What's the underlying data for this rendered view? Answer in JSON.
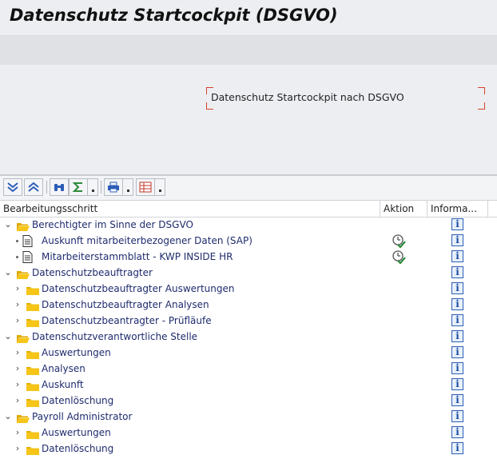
{
  "window": {
    "title": "Datenschutz Startcockpit (DSGVO)"
  },
  "header": {
    "text": "Datenschutz Startcockpit nach DSGVO"
  },
  "toolbar": {
    "buttons": [
      {
        "name": "expand-all-button",
        "icon": "expand-down-icon"
      },
      {
        "name": "collapse-all-button",
        "icon": "collapse-up-icon"
      },
      {
        "name": "find-button",
        "icon": "binoculars-icon"
      },
      {
        "name": "sum-button",
        "icon": "sigma-icon"
      },
      {
        "name": "print-button",
        "icon": "printer-icon"
      },
      {
        "name": "layout-button",
        "icon": "grid-layout-icon"
      }
    ]
  },
  "table": {
    "columns": {
      "step": "Bearbeitungsschritt",
      "action": "Aktion",
      "info": "Informa..."
    },
    "rows": [
      {
        "label": "Berechtigter im Sinne der DSGVO",
        "level": 0,
        "type": "folder-open",
        "expanded": true,
        "action": false
      },
      {
        "label": "Auskunft mitarbeiterbezogener Daten (SAP)",
        "level": 1,
        "type": "document",
        "action": true
      },
      {
        "label": "Mitarbeiterstammblatt - KWP INSIDE HR",
        "level": 1,
        "type": "document",
        "action": true
      },
      {
        "label": "Datenschutzbeauftragter",
        "level": 0,
        "type": "folder-open",
        "expanded": true,
        "action": false
      },
      {
        "label": "Datenschutzbeauftragter Auswertungen",
        "level": 1,
        "type": "folder",
        "expanded": false,
        "action": false
      },
      {
        "label": "Datenschutzbeauftragter Analysen",
        "level": 1,
        "type": "folder",
        "expanded": false,
        "action": false
      },
      {
        "label": "Datenschutzbeantragter - Prüfläufe",
        "level": 1,
        "type": "folder",
        "expanded": false,
        "action": false
      },
      {
        "label": "Datenschutzverantwortliche Stelle",
        "level": 0,
        "type": "folder-open",
        "expanded": true,
        "action": false
      },
      {
        "label": "Auswertungen",
        "level": 1,
        "type": "folder",
        "expanded": false,
        "action": false
      },
      {
        "label": "Analysen",
        "level": 1,
        "type": "folder",
        "expanded": false,
        "action": false
      },
      {
        "label": "Auskunft",
        "level": 1,
        "type": "folder",
        "expanded": false,
        "action": false
      },
      {
        "label": "Datenlöschung",
        "level": 1,
        "type": "folder",
        "expanded": false,
        "action": false
      },
      {
        "label": "Payroll Administrator",
        "level": 0,
        "type": "folder-open",
        "expanded": true,
        "action": false
      },
      {
        "label": "Auswertungen",
        "level": 1,
        "type": "folder",
        "expanded": false,
        "action": false
      },
      {
        "label": "Datenlöschung",
        "level": 1,
        "type": "folder",
        "expanded": false,
        "action": false
      }
    ],
    "info_glyph": "i"
  },
  "colors": {
    "folder": "#f5c518",
    "folder_dark": "#e0a800",
    "info_border": "#2d5db8",
    "label": "#1f2b6e",
    "header_bracket": "#d9432a"
  }
}
